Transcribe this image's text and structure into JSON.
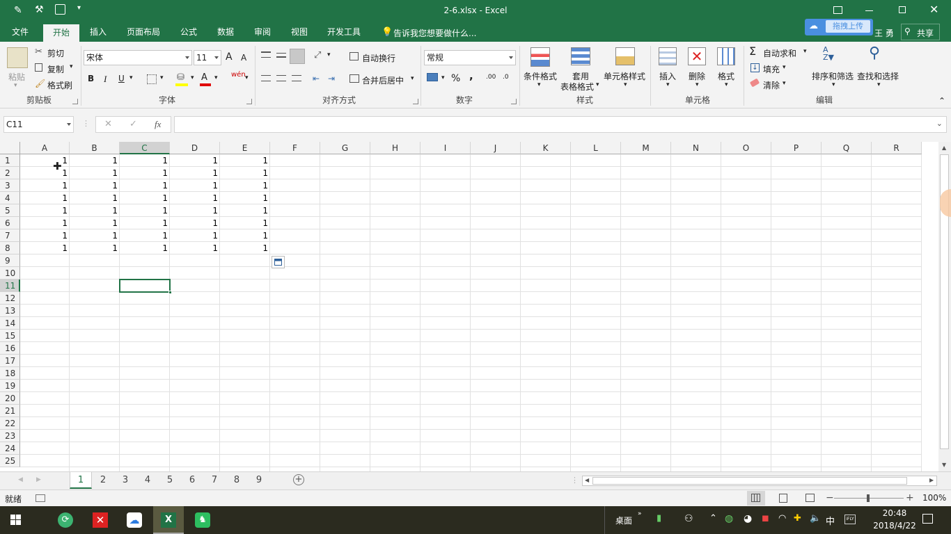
{
  "window": {
    "title": "2-6.xlsx - Excel",
    "user": "王 勇",
    "share": "共享",
    "upload": "拖拽上传"
  },
  "ribbon_tabs": [
    "文件",
    "开始",
    "插入",
    "页面布局",
    "公式",
    "数据",
    "审阅",
    "视图",
    "开发工具"
  ],
  "active_tab": "开始",
  "tell_me": "告诉我您想要做什么...",
  "clipboard": {
    "paste": "粘贴",
    "cut": "剪切",
    "copy": "复制",
    "format_painter": "格式刷",
    "group": "剪贴板"
  },
  "font": {
    "name": "宋体",
    "size": "11",
    "bold": "B",
    "italic": "I",
    "underline": "U",
    "group": "字体",
    "grow": "A",
    "shrink": "A",
    "wen": "wén"
  },
  "alignment": {
    "wrap": "自动换行",
    "merge": "合并后居中",
    "group": "对齐方式"
  },
  "number": {
    "format": "常规",
    "percent": "%",
    "comma": ",",
    "inc": ".00",
    "dec": ".0",
    "group": "数字"
  },
  "styles": {
    "conditional": "条件格式",
    "table1": "套用",
    "table2": "表格格式",
    "cell_styles": "单元格样式",
    "group": "样式"
  },
  "cells": {
    "insert": "插入",
    "delete": "删除",
    "format": "格式",
    "group": "单元格"
  },
  "editing": {
    "autosum": "自动求和",
    "fill": "填充",
    "clear": "清除",
    "sort": "排序和筛选",
    "find": "查找和选择",
    "group": "编辑"
  },
  "formula_bar": {
    "name_box": "C11",
    "fx": "fx",
    "value": ""
  },
  "columns": [
    "A",
    "B",
    "C",
    "D",
    "E",
    "F",
    "G",
    "H",
    "I",
    "J",
    "K",
    "L",
    "M",
    "N",
    "O",
    "P",
    "Q",
    "R"
  ],
  "rows": [
    "1",
    "2",
    "3",
    "4",
    "5",
    "6",
    "7",
    "8",
    "9",
    "10",
    "11",
    "12",
    "13",
    "14",
    "15",
    "16",
    "17",
    "18",
    "19",
    "20",
    "21",
    "22",
    "23",
    "24",
    "25"
  ],
  "table": [
    [
      "1",
      "1",
      "1",
      "1",
      "1"
    ],
    [
      "1",
      "1",
      "1",
      "1",
      "1"
    ],
    [
      "1",
      "1",
      "1",
      "1",
      "1"
    ],
    [
      "1",
      "1",
      "1",
      "1",
      "1"
    ],
    [
      "1",
      "1",
      "1",
      "1",
      "1"
    ],
    [
      "1",
      "1",
      "1",
      "1",
      "1"
    ],
    [
      "1",
      "1",
      "1",
      "1",
      "1"
    ],
    [
      "1",
      "1",
      "1",
      "1",
      "1"
    ]
  ],
  "active_cell": "C11",
  "sheets": [
    "1",
    "2",
    "3",
    "4",
    "5",
    "6",
    "7",
    "8",
    "9"
  ],
  "active_sheet": "1",
  "status": {
    "ready": "就绪",
    "zoom": "100%"
  },
  "taskbar": {
    "desktop": "桌面",
    "ime": "中",
    "time": "20:48",
    "date": "2018/4/22"
  },
  "colors": {
    "excel_green": "#217346",
    "ribbon_bg": "#f3f3f3",
    "taskbar_bg": "#2b2b1f"
  }
}
